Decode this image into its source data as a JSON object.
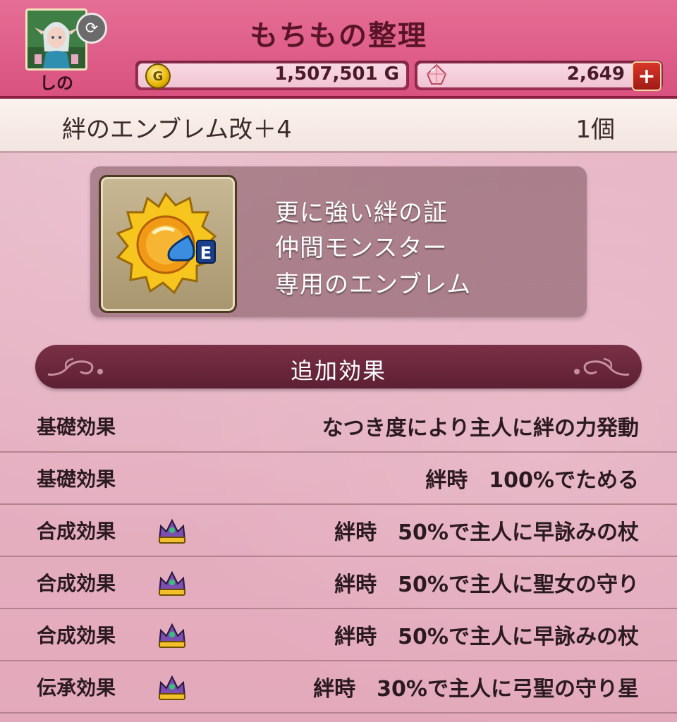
{
  "header": {
    "title": "もちもの整理",
    "player_name": "しの",
    "gold": "1,507,501 G",
    "gems": "2,649",
    "add_gems_label": "+",
    "swap_icon": "refresh-icon",
    "coin_letter": "G",
    "colors": {
      "header": "#d9527f",
      "border": "#8b1e43"
    }
  },
  "item": {
    "name": "絆のエンブレム改＋4",
    "count": "1個",
    "icon_badge": "E",
    "description": [
      "更に強い絆の証",
      "仲間モンスター",
      "専用のエンブレム"
    ]
  },
  "section": {
    "title": "追加効果"
  },
  "effects": [
    {
      "type": "基礎効果",
      "crown": false,
      "text": "なつき度により主人に絆の力発動"
    },
    {
      "type": "基礎効果",
      "crown": false,
      "text": "絆時　100%でためる"
    },
    {
      "type": "合成効果",
      "crown": true,
      "text": "絆時　50%で主人に早詠みの杖"
    },
    {
      "type": "合成効果",
      "crown": true,
      "text": "絆時　50%で主人に聖女の守り"
    },
    {
      "type": "合成効果",
      "crown": true,
      "text": "絆時　50%で主人に早詠みの杖"
    },
    {
      "type": "伝承効果",
      "crown": true,
      "text": "絆時　30%で主人に弓聖の守り星"
    }
  ]
}
